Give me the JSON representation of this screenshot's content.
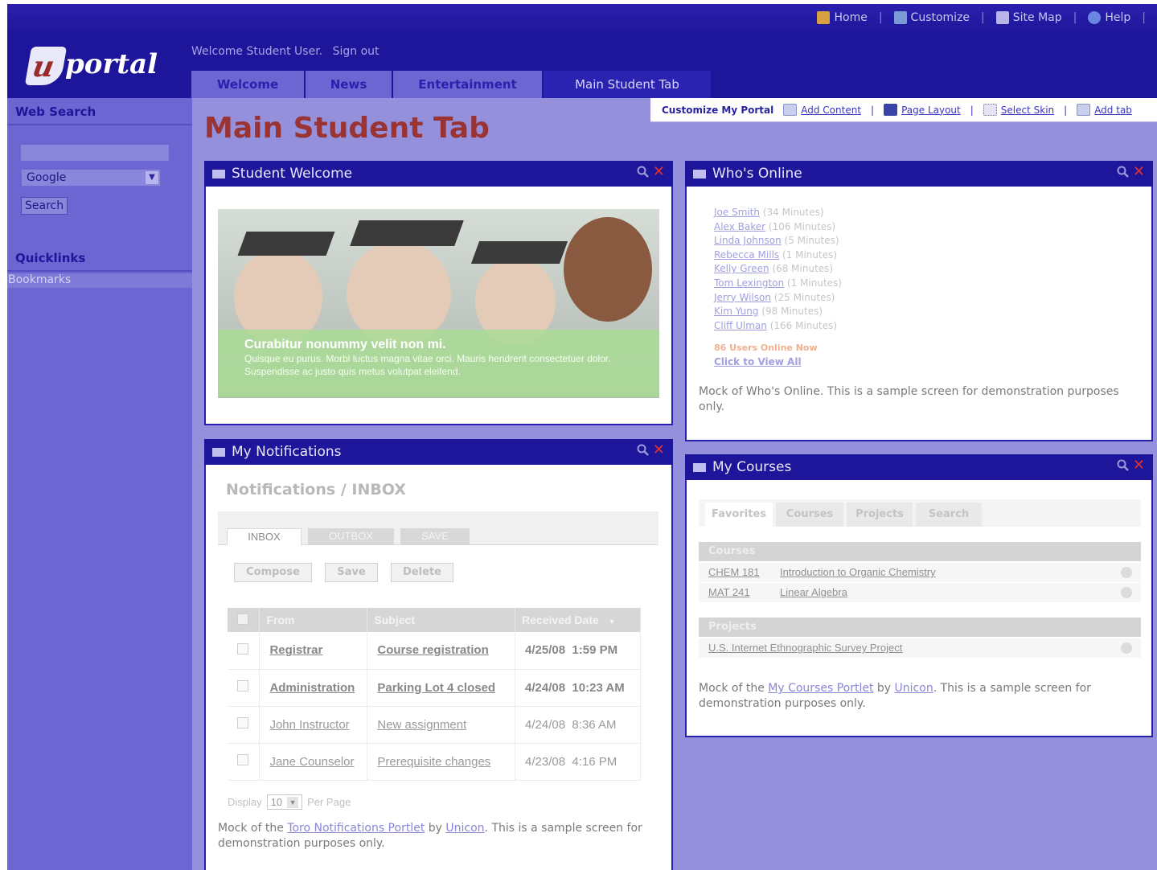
{
  "top_links": {
    "home": "Home",
    "customize": "Customize",
    "site_map": "Site Map",
    "help": "Help",
    "separator": "|"
  },
  "header": {
    "logo_text": "portal",
    "logo_letter": "u",
    "welcome": "Welcome Student User.",
    "sign_out": "Sign out",
    "tabs": [
      {
        "label": "Welcome",
        "active": false
      },
      {
        "label": "News",
        "active": false
      },
      {
        "label": "Entertainment",
        "active": false
      },
      {
        "label": "Main Student Tab",
        "active": true
      }
    ]
  },
  "sidebar": {
    "web_search": {
      "title": "Web Search",
      "input_value": "",
      "engine": "Google",
      "button": "Search"
    },
    "quicklinks": {
      "title": "Quicklinks",
      "items": [
        "Bookmarks"
      ]
    }
  },
  "toolbar": {
    "title": "Customize My Portal",
    "add_content": "Add Content",
    "page_layout": "Page Layout",
    "select_skin": "Select Skin",
    "add_tab": "Add tab",
    "separator": "|"
  },
  "page_title": "Main Student Tab",
  "portlets": {
    "student_welcome": {
      "title": "Student Welcome",
      "banner_title": "Curabitur nonummy velit non mi.",
      "banner_text": "Quisque eu purus. Morbi luctus magna vitae orci. Mauris hendrerit consectetuer dolor. Suspendisse ac justo quis metus volutpat eleifend."
    },
    "whos_online": {
      "title": "Who's Online",
      "users": [
        {
          "name": "Joe Smith",
          "minutes": "(34 Minutes)"
        },
        {
          "name": "Alex Baker",
          "minutes": "(106 Minutes)"
        },
        {
          "name": "Linda Johnson",
          "minutes": "(5 Minutes)"
        },
        {
          "name": "Rebecca Mills",
          "minutes": "(1 Minutes)"
        },
        {
          "name": "Kelly Green",
          "minutes": "(68 Minutes)"
        },
        {
          "name": "Tom Lexington",
          "minutes": "(1 Minutes)"
        },
        {
          "name": "Jerry Wilson",
          "minutes": "(25 Minutes)"
        },
        {
          "name": "Kim Yung",
          "minutes": "(98 Minutes)"
        },
        {
          "name": "Cliff Ulman",
          "minutes": "(166 Minutes)"
        }
      ],
      "online_count": "86 Users Online Now",
      "view_all": "Click to View All",
      "note": "Mock of Who's Online. This is a sample screen for demonstration purposes only."
    },
    "notifications": {
      "title": "My Notifications",
      "heading": "Notifications / INBOX",
      "tabs": [
        "INBOX",
        "OUTBOX",
        "SAVE"
      ],
      "buttons": [
        "Compose",
        "Save",
        "Delete"
      ],
      "columns": [
        "From",
        "Subject",
        "Received Date"
      ],
      "rows": [
        {
          "from": "Registrar",
          "subject": "Course registration",
          "date": "4/25/08  1:59 PM",
          "unread": true
        },
        {
          "from": "Administration",
          "subject": "Parking Lot 4 closed",
          "date": "4/24/08  10:23 AM",
          "unread": true
        },
        {
          "from": "John Instructor",
          "subject": "New assignment",
          "date": "4/24/08  8:36 AM",
          "unread": false
        },
        {
          "from": "Jane Counselor",
          "subject": "Prerequisite changes",
          "date": "4/23/08  4:16 PM",
          "unread": false
        }
      ],
      "display_label": "Display",
      "display_value": "10",
      "per_page": "Per Page",
      "note_prefix": "Mock of the",
      "note_link": "Toro Notifications Portlet",
      "note_by": "by",
      "note_vendor": "Unicon",
      "note_suffix": ". This is a sample screen for demonstration purposes only."
    },
    "courses": {
      "title": "My Courses",
      "tabs": [
        "Favorites",
        "Courses",
        "Projects",
        "Search"
      ],
      "courses_header": "Courses",
      "courses": [
        {
          "code": "CHEM 181",
          "name": "Introduction to Organic Chemistry"
        },
        {
          "code": "MAT 241",
          "name": "Linear Algebra"
        }
      ],
      "projects_header": "Projects",
      "projects": [
        "U.S. Internet Ethnographic Survey Project"
      ],
      "note_prefix": "Mock of the",
      "note_link": "My Courses Portlet",
      "note_by": "by",
      "note_vendor": "Unicon",
      "note_suffix": ". This is a sample screen for demonstration purposes only."
    }
  },
  "colors": {
    "header_blue": "#1e169a",
    "page_bg": "#9590dc",
    "title_red": "#9a3434",
    "close_red": "#e03030"
  }
}
